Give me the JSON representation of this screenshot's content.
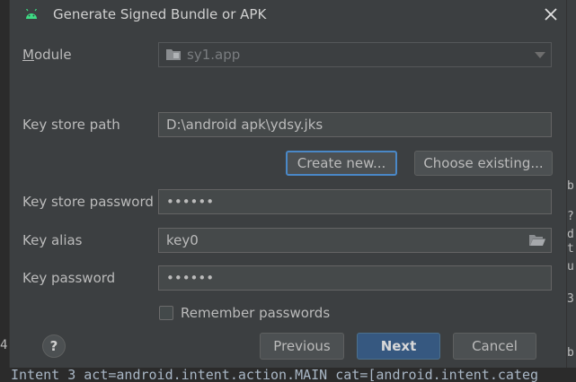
{
  "dialog": {
    "title": "Generate Signed Bundle or APK",
    "module": {
      "label": "Module",
      "value": "sy1.app"
    },
    "key_store_path": {
      "label": "Key store path",
      "value": "D:\\android apk\\ydsy.jks"
    },
    "create_new_label": "Create new...",
    "choose_existing_label": "Choose existing...",
    "key_store_password": {
      "label": "Key store password",
      "value": "••••••"
    },
    "key_alias": {
      "label": "Key alias",
      "value": "key0"
    },
    "key_password": {
      "label": "Key password",
      "value": "••••••"
    },
    "remember_passwords": {
      "label": "Remember passwords",
      "checked": false
    },
    "buttons": {
      "previous": "Previous",
      "next": "Next",
      "cancel": "Cancel"
    },
    "help_label": "?"
  },
  "background": {
    "console_line": "Intent 3 act=android.intent.action.MAIN cat=[android.intent.categ",
    "left_digit": "4",
    "right_fragments": [
      "b",
      "?",
      "d",
      "t",
      "u",
      "3",
      "b"
    ]
  },
  "icons": {
    "app": "android-icon",
    "close": "close-icon",
    "folder": "folder-icon",
    "dropdown": "chevron-down-icon",
    "browse": "folder-open-icon"
  },
  "colors": {
    "accent": "#4a88c7",
    "primary_button": "#365880",
    "dialog_bg": "#3c3f41"
  }
}
